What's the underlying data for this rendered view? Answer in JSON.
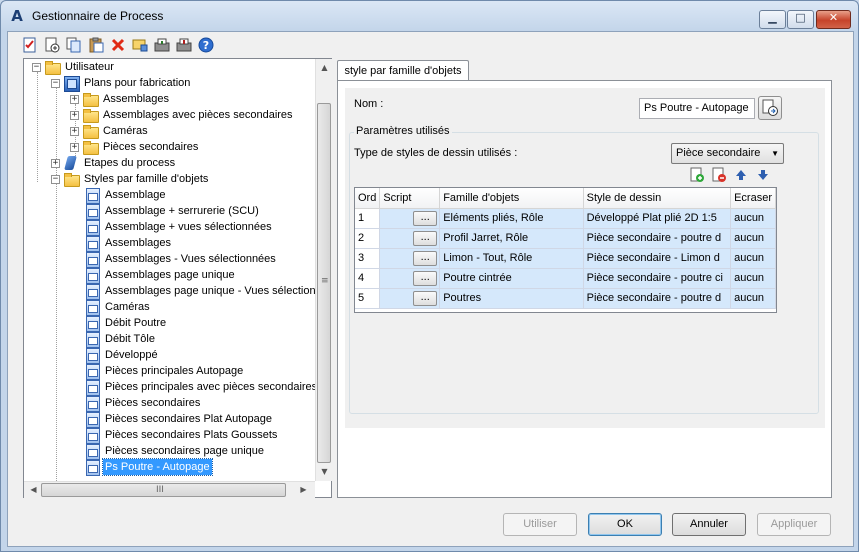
{
  "window": {
    "title": "Gestionnaire de Process",
    "app_icon": "autocad-a-icon",
    "controls": {
      "minimize": "minimize-icon",
      "maximize": "maximize-icon",
      "close": "close-icon"
    }
  },
  "toolbar": [
    {
      "icon": "checklist-icon"
    },
    {
      "icon": "new-document-icon"
    },
    {
      "icon": "copy-icon"
    },
    {
      "icon": "paste-icon"
    },
    {
      "icon": "delete-x-icon"
    },
    {
      "icon": "rename-icon"
    },
    {
      "icon": "import-icon"
    },
    {
      "icon": "export-icon"
    },
    {
      "icon": "help-icon"
    }
  ],
  "tree": {
    "root": "Utilisateur",
    "nodes": [
      {
        "label": "Plans pour fabrication",
        "level": 1,
        "icon": "plan-icon",
        "expanded": true
      },
      {
        "label": "Assemblages",
        "level": 2,
        "icon": "folder-icon"
      },
      {
        "label": "Assemblages avec pièces secondaires",
        "level": 2,
        "icon": "folder-icon"
      },
      {
        "label": "Caméras",
        "level": 2,
        "icon": "folder-icon"
      },
      {
        "label": "Pièces secondaires",
        "level": 2,
        "icon": "folder-icon"
      },
      {
        "label": "Etapes du process",
        "level": 1,
        "icon": "process-step-icon"
      },
      {
        "label": "Styles par famille d'objets",
        "level": 1,
        "icon": "folder-icon",
        "expanded": true
      },
      {
        "label": "Assemblage",
        "level": 2,
        "icon": "style-icon"
      },
      {
        "label": "Assemblage + serrurerie (SCU)",
        "level": 2,
        "icon": "style-icon"
      },
      {
        "label": "Assemblage + vues sélectionnées",
        "level": 2,
        "icon": "style-icon"
      },
      {
        "label": "Assemblages",
        "level": 2,
        "icon": "style-icon"
      },
      {
        "label": "Assemblages - Vues sélectionnées",
        "level": 2,
        "icon": "style-icon"
      },
      {
        "label": "Assemblages page unique",
        "level": 2,
        "icon": "style-icon"
      },
      {
        "label": "Assemblages page unique - Vues sélectionn",
        "level": 2,
        "icon": "style-icon"
      },
      {
        "label": "Caméras",
        "level": 2,
        "icon": "style-icon"
      },
      {
        "label": "Débit Poutre",
        "level": 2,
        "icon": "style-icon"
      },
      {
        "label": "Débit Tôle",
        "level": 2,
        "icon": "style-icon"
      },
      {
        "label": "Développé",
        "level": 2,
        "icon": "style-icon"
      },
      {
        "label": "Pièces principales Autopage",
        "level": 2,
        "icon": "style-icon"
      },
      {
        "label": "Pièces principales avec pièces secondaires",
        "level": 2,
        "icon": "style-icon"
      },
      {
        "label": "Pièces secondaires",
        "level": 2,
        "icon": "style-icon"
      },
      {
        "label": "Pièces secondaires Plat Autopage",
        "level": 2,
        "icon": "style-icon"
      },
      {
        "label": "Pièces secondaires Plats Goussets",
        "level": 2,
        "icon": "style-icon"
      },
      {
        "label": "Pièces secondaires page unique",
        "level": 2,
        "icon": "style-icon"
      },
      {
        "label": "Ps Poutre - Autopage",
        "level": 2,
        "icon": "style-icon",
        "selected": true
      }
    ],
    "hscroll_grip": "III"
  },
  "tab": {
    "label": "style par famille d'objets"
  },
  "form": {
    "nom_label": "Nom :",
    "nom_value": "Ps Poutre - Autopage",
    "group_label": "Paramètres utilisés",
    "type_label": "Type de styles de dessin utilisés :",
    "type_value": "Pièce secondaire",
    "mini_tools": [
      "add-row-icon",
      "remove-row-icon",
      "move-up-icon",
      "move-down-icon"
    ]
  },
  "grid": {
    "columns": [
      "Ord",
      "Script",
      "Famille d'objets",
      "Style de dessin",
      "Ecraser"
    ],
    "ellipsis": "...",
    "rows": [
      {
        "ord": "1",
        "famille": "Eléments pliés, Rôle",
        "style": "Développé Plat plié 2D 1:5",
        "ecraser": "aucun"
      },
      {
        "ord": "2",
        "famille": "Profil Jarret, Rôle",
        "style": "Pièce secondaire - poutre d",
        "ecraser": "aucun"
      },
      {
        "ord": "3",
        "famille": "Limon - Tout, Rôle",
        "style": "Pièce secondaire - Limon d",
        "ecraser": "aucun"
      },
      {
        "ord": "4",
        "famille": "Poutre cintrée",
        "style": "Pièce secondaire - poutre ci",
        "ecraser": "aucun"
      },
      {
        "ord": "5",
        "famille": "Poutres",
        "style": "Pièce secondaire - poutre d",
        "ecraser": "aucun"
      }
    ]
  },
  "buttons": {
    "utiliser": "Utiliser",
    "ok": "OK",
    "annuler": "Annuler",
    "appliquer": "Appliquer"
  }
}
